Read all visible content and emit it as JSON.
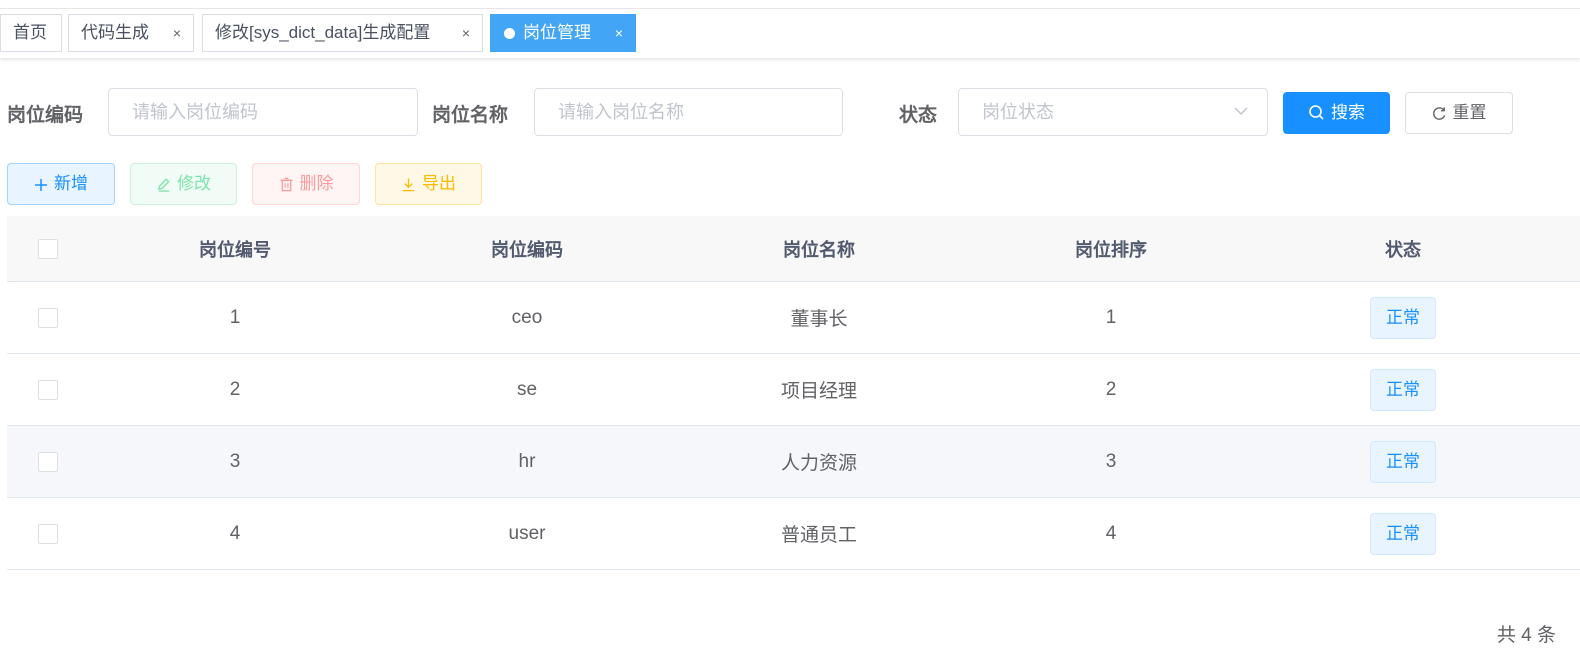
{
  "tags": [
    {
      "label": "首页",
      "closable": false,
      "active": false
    },
    {
      "label": "代码生成",
      "closable": true,
      "active": false
    },
    {
      "label": "修改[sys_dict_data]生成配置",
      "closable": true,
      "active": false
    },
    {
      "label": "岗位管理",
      "closable": true,
      "active": true
    }
  ],
  "close_glyph": "×",
  "search": {
    "post_code": {
      "label": "岗位编码",
      "placeholder": "请输入岗位编码"
    },
    "post_name": {
      "label": "岗位名称",
      "placeholder": "请输入岗位名称"
    },
    "status": {
      "label": "状态",
      "placeholder": "岗位状态"
    },
    "search_button": "搜索",
    "reset_button": "重置"
  },
  "toolbar": {
    "add": "新增",
    "edit": "修改",
    "delete": "删除",
    "export": "导出"
  },
  "table": {
    "columns": [
      "岗位编号",
      "岗位编码",
      "岗位名称",
      "岗位排序",
      "状态"
    ],
    "rows": [
      {
        "id": "1",
        "code": "ceo",
        "name": "董事长",
        "sort": "1",
        "status": "正常"
      },
      {
        "id": "2",
        "code": "se",
        "name": "项目经理",
        "sort": "2",
        "status": "正常"
      },
      {
        "id": "3",
        "code": "hr",
        "name": "人力资源",
        "sort": "3",
        "status": "正常"
      },
      {
        "id": "4",
        "code": "user",
        "name": "普通员工",
        "sort": "4",
        "status": "正常"
      }
    ]
  },
  "pagination": {
    "total_text": "共 4 条"
  },
  "colors": {
    "primary": "#1890ff",
    "active_tag": "#42a5f5",
    "success": "#13ce66",
    "danger": "#ff4949",
    "warning": "#ffba00"
  }
}
